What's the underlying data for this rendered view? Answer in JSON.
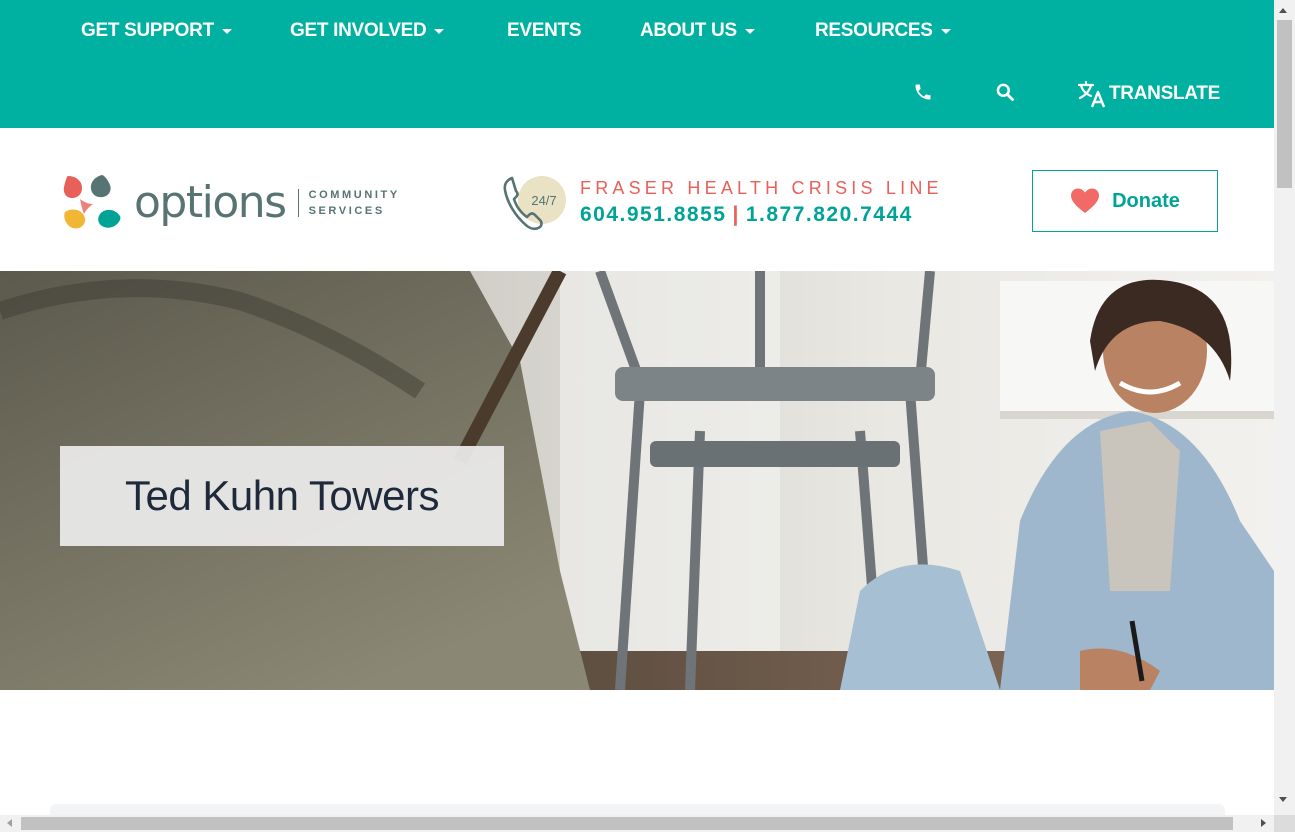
{
  "nav": {
    "items": [
      {
        "label": "GET SUPPORT",
        "dropdown": true
      },
      {
        "label": "GET INVOLVED",
        "dropdown": true
      },
      {
        "label": "EVENTS",
        "dropdown": false
      },
      {
        "label": "ABOUT US",
        "dropdown": true
      },
      {
        "label": "RESOURCES",
        "dropdown": true
      }
    ],
    "phone_icon": "phone-icon",
    "search_icon": "search-icon",
    "translate_icon": "translate-icon",
    "translate_label": "TRANSLATE"
  },
  "logo": {
    "wordmark": "options",
    "sub_line1": "COMMUNITY",
    "sub_line2": "SERVICES",
    "colors": [
      "#e8605a",
      "#f2b635",
      "#00a396",
      "#577472"
    ]
  },
  "crisis": {
    "badge": "24/7",
    "title": "FRASER HEALTH CRISIS LINE",
    "phone1": "604.951.8855",
    "separator": "|",
    "phone2": "1.877.820.7444"
  },
  "donate": {
    "label": "Donate",
    "icon": "heart-icon"
  },
  "hero": {
    "title": "Ted Kuhn Towers"
  },
  "colors": {
    "nav_bg": "#00b0a0",
    "accent": "#00a396",
    "coral": "#e8605a",
    "title_text": "#1e2a3a"
  }
}
